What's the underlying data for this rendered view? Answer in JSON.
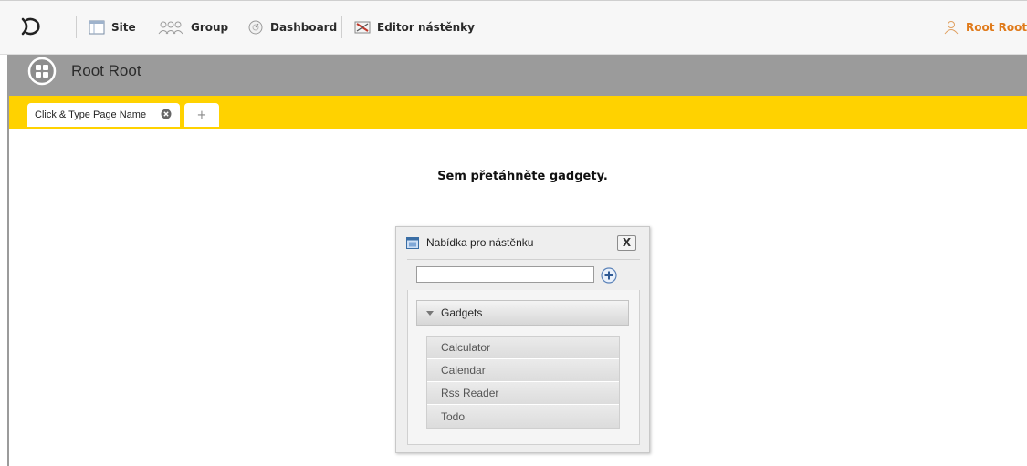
{
  "toolbar": {
    "items": [
      {
        "label": "Site",
        "icon": "site-icon"
      },
      {
        "label": "Group",
        "icon": "group-icon"
      },
      {
        "label": "Dashboard",
        "icon": "dashboard-icon"
      },
      {
        "label": "Editor nástěnky",
        "icon": "editor-icon"
      }
    ],
    "user": {
      "label": "Root Root",
      "icon": "user-icon"
    }
  },
  "header": {
    "title": "Root Root",
    "icon": "dashboard-grid-icon"
  },
  "tabs": {
    "active_label": "Click & Type Page Name",
    "add_label": "+"
  },
  "workspace": {
    "drop_message": "Sem přetáhněte gadgety."
  },
  "panel": {
    "title": "Nabídka pro nástěnku",
    "close_label": "X",
    "search": {
      "value": "",
      "placeholder": ""
    },
    "category": {
      "label": "Gadgets"
    },
    "gadgets": [
      "Calculator",
      "Calendar",
      "Rss Reader",
      "Todo"
    ]
  },
  "colors": {
    "accent_yellow": "#ffd200",
    "header_grey": "#9b9b9b",
    "user_orange": "#e07a1a"
  }
}
